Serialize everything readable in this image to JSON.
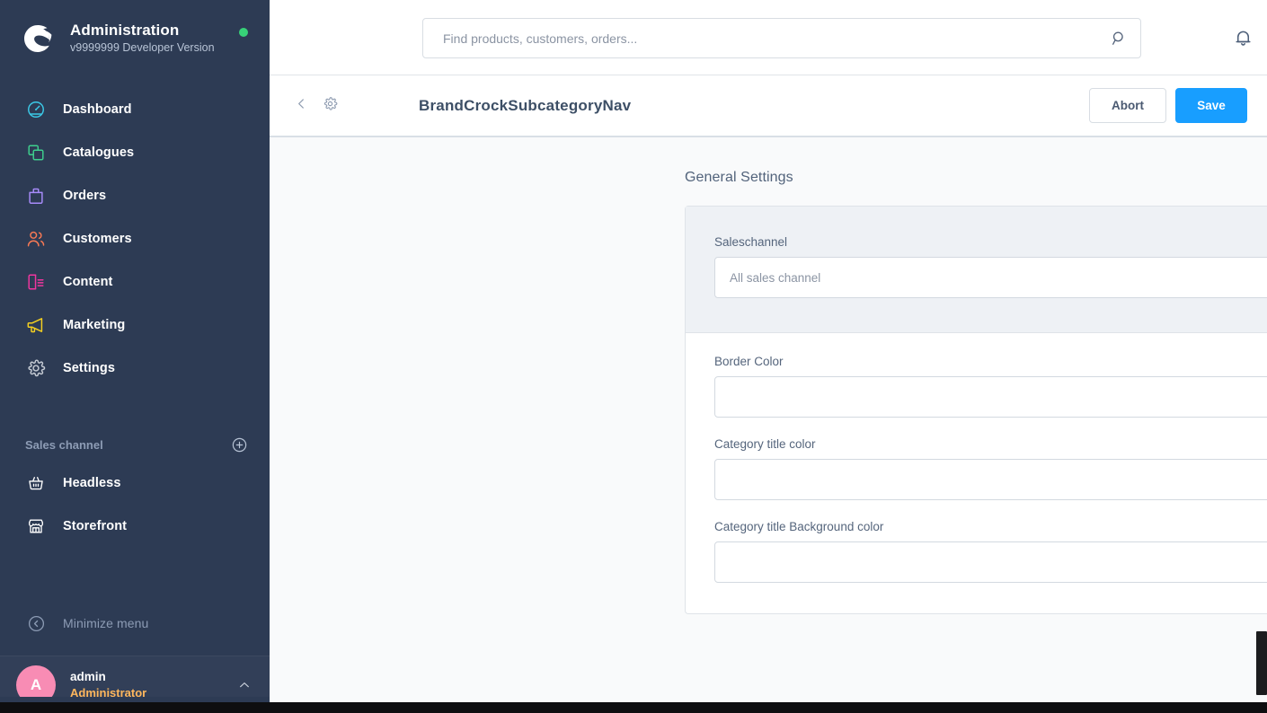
{
  "sidebar": {
    "brand": {
      "title": "Administration",
      "version": "v9999999 Developer Version",
      "logo_icon": "shopware-logo-icon",
      "status_dot": "online-status-dot"
    },
    "nav": [
      {
        "label": "Dashboard",
        "icon": "dashboard-icon",
        "color": "#3bc9e7"
      },
      {
        "label": "Catalogues",
        "icon": "catalogues-icon",
        "color": "#3ecf8e"
      },
      {
        "label": "Orders",
        "icon": "orders-bag-icon",
        "color": "#a78bfa"
      },
      {
        "label": "Customers",
        "icon": "customers-icon",
        "color": "#f97a54"
      },
      {
        "label": "Content",
        "icon": "content-icon",
        "color": "#f0369f"
      },
      {
        "label": "Marketing",
        "icon": "marketing-megaphone-icon",
        "color": "#f5d020"
      },
      {
        "label": "Settings",
        "icon": "settings-gear-icon",
        "color": "#c5cbd4"
      }
    ],
    "section": {
      "label": "Sales channel",
      "add_icon": "plus-circle-icon"
    },
    "channels": [
      {
        "label": "Headless",
        "icon": "headless-basket-icon"
      },
      {
        "label": "Storefront",
        "icon": "storefront-icon"
      }
    ],
    "minimize": {
      "label": "Minimize menu",
      "icon": "chevron-left-circle-icon"
    },
    "user": {
      "initial": "A",
      "name": "admin",
      "role": "Administrator",
      "caret_icon": "chevron-up-icon",
      "avatar_color": "#f88cb4"
    }
  },
  "topbar": {
    "search": {
      "value": "",
      "placeholder": "Find products, customers, orders...",
      "icon": "search-icon"
    },
    "notifications_icon": "bell-icon"
  },
  "titlebar": {
    "back_icon": "chevron-left-icon",
    "gear_icon": "gear-icon",
    "title": "BrandCrockSubcategoryNav",
    "abort_label": "Abort",
    "save_label": "Save",
    "save_color": "#189eff"
  },
  "main": {
    "section_title": "General Settings",
    "saleschannel": {
      "label": "Saleschannel",
      "value": "",
      "placeholder": "All sales channel",
      "caret_icon": "chevron-down-icon"
    },
    "fields": [
      {
        "label": "Border Color",
        "value": "",
        "placeholder": ""
      },
      {
        "label": "Category title color",
        "value": "",
        "placeholder": ""
      },
      {
        "label": "Category title Background color",
        "value": "",
        "placeholder": ""
      }
    ]
  }
}
